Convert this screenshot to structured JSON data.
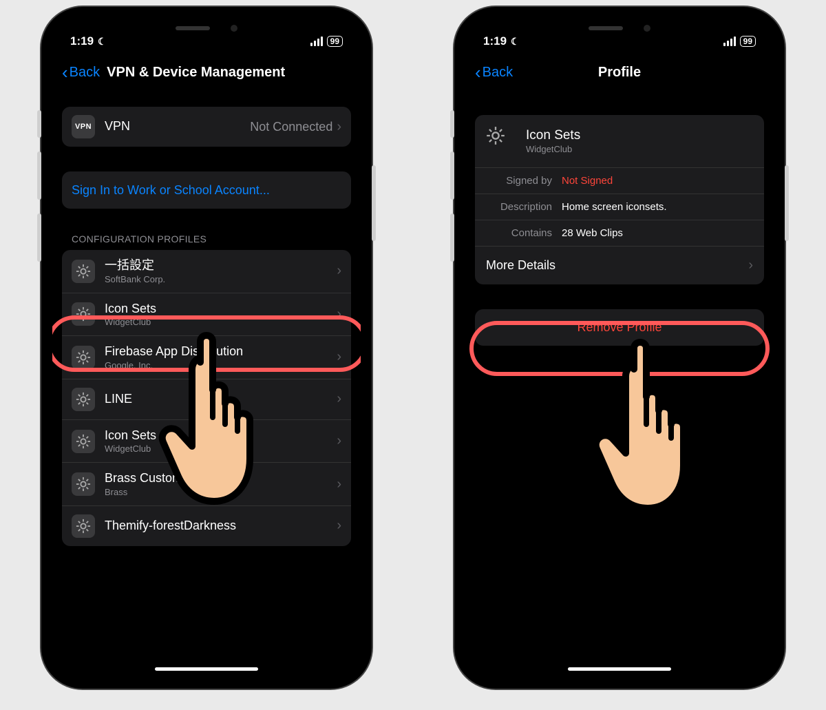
{
  "status": {
    "time": "1:19",
    "battery": "99"
  },
  "phone1": {
    "back": "Back",
    "title": "VPN & Device Management",
    "vpn": {
      "label": "VPN",
      "status": "Not Connected",
      "icon_text": "VPN"
    },
    "signin": "Sign In to Work or School Account...",
    "section": "CONFIGURATION PROFILES",
    "profiles": [
      {
        "title": "一括設定",
        "sub": "SoftBank Corp."
      },
      {
        "title": "Icon Sets",
        "sub": "WidgetClub"
      },
      {
        "title": "Firebase App Distribution",
        "sub": "Google, Inc."
      },
      {
        "title": "LINE",
        "sub": ""
      },
      {
        "title": "Icon Sets",
        "sub": "WidgetClub"
      },
      {
        "title": "Brass Custom Icons",
        "sub": "Brass"
      },
      {
        "title": "Themify-forestDarkness",
        "sub": ""
      }
    ]
  },
  "phone2": {
    "back": "Back",
    "title": "Profile",
    "profile": {
      "title": "Icon Sets",
      "sub": "WidgetClub"
    },
    "rows": {
      "signed_by_label": "Signed by",
      "signed_by_value": "Not Signed",
      "description_label": "Description",
      "description_value": "Home screen iconsets.",
      "contains_label": "Contains",
      "contains_value": "28 Web Clips"
    },
    "more": "More Details",
    "remove": "Remove Profile"
  }
}
